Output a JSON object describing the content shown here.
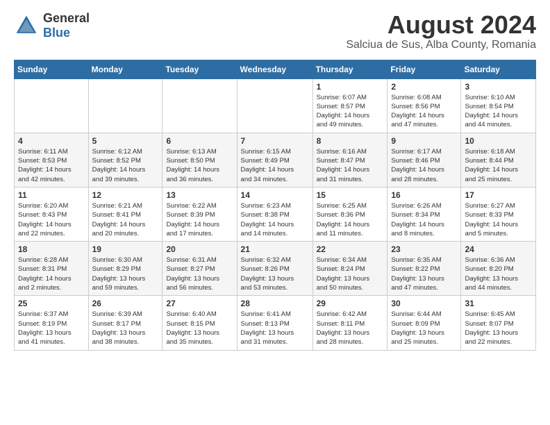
{
  "header": {
    "logo_general": "General",
    "logo_blue": "Blue",
    "month_title": "August 2024",
    "location": "Salciua de Sus, Alba County, Romania"
  },
  "calendar": {
    "days_of_week": [
      "Sunday",
      "Monday",
      "Tuesday",
      "Wednesday",
      "Thursday",
      "Friday",
      "Saturday"
    ],
    "weeks": [
      [
        {
          "day": "",
          "info": ""
        },
        {
          "day": "",
          "info": ""
        },
        {
          "day": "",
          "info": ""
        },
        {
          "day": "",
          "info": ""
        },
        {
          "day": "1",
          "info": "Sunrise: 6:07 AM\nSunset: 8:57 PM\nDaylight: 14 hours\nand 49 minutes."
        },
        {
          "day": "2",
          "info": "Sunrise: 6:08 AM\nSunset: 8:56 PM\nDaylight: 14 hours\nand 47 minutes."
        },
        {
          "day": "3",
          "info": "Sunrise: 6:10 AM\nSunset: 8:54 PM\nDaylight: 14 hours\nand 44 minutes."
        }
      ],
      [
        {
          "day": "4",
          "info": "Sunrise: 6:11 AM\nSunset: 8:53 PM\nDaylight: 14 hours\nand 42 minutes."
        },
        {
          "day": "5",
          "info": "Sunrise: 6:12 AM\nSunset: 8:52 PM\nDaylight: 14 hours\nand 39 minutes."
        },
        {
          "day": "6",
          "info": "Sunrise: 6:13 AM\nSunset: 8:50 PM\nDaylight: 14 hours\nand 36 minutes."
        },
        {
          "day": "7",
          "info": "Sunrise: 6:15 AM\nSunset: 8:49 PM\nDaylight: 14 hours\nand 34 minutes."
        },
        {
          "day": "8",
          "info": "Sunrise: 6:16 AM\nSunset: 8:47 PM\nDaylight: 14 hours\nand 31 minutes."
        },
        {
          "day": "9",
          "info": "Sunrise: 6:17 AM\nSunset: 8:46 PM\nDaylight: 14 hours\nand 28 minutes."
        },
        {
          "day": "10",
          "info": "Sunrise: 6:18 AM\nSunset: 8:44 PM\nDaylight: 14 hours\nand 25 minutes."
        }
      ],
      [
        {
          "day": "11",
          "info": "Sunrise: 6:20 AM\nSunset: 8:43 PM\nDaylight: 14 hours\nand 22 minutes."
        },
        {
          "day": "12",
          "info": "Sunrise: 6:21 AM\nSunset: 8:41 PM\nDaylight: 14 hours\nand 20 minutes."
        },
        {
          "day": "13",
          "info": "Sunrise: 6:22 AM\nSunset: 8:39 PM\nDaylight: 14 hours\nand 17 minutes."
        },
        {
          "day": "14",
          "info": "Sunrise: 6:23 AM\nSunset: 8:38 PM\nDaylight: 14 hours\nand 14 minutes."
        },
        {
          "day": "15",
          "info": "Sunrise: 6:25 AM\nSunset: 8:36 PM\nDaylight: 14 hours\nand 11 minutes."
        },
        {
          "day": "16",
          "info": "Sunrise: 6:26 AM\nSunset: 8:34 PM\nDaylight: 14 hours\nand 8 minutes."
        },
        {
          "day": "17",
          "info": "Sunrise: 6:27 AM\nSunset: 8:33 PM\nDaylight: 14 hours\nand 5 minutes."
        }
      ],
      [
        {
          "day": "18",
          "info": "Sunrise: 6:28 AM\nSunset: 8:31 PM\nDaylight: 14 hours\nand 2 minutes."
        },
        {
          "day": "19",
          "info": "Sunrise: 6:30 AM\nSunset: 8:29 PM\nDaylight: 13 hours\nand 59 minutes."
        },
        {
          "day": "20",
          "info": "Sunrise: 6:31 AM\nSunset: 8:27 PM\nDaylight: 13 hours\nand 56 minutes."
        },
        {
          "day": "21",
          "info": "Sunrise: 6:32 AM\nSunset: 8:26 PM\nDaylight: 13 hours\nand 53 minutes."
        },
        {
          "day": "22",
          "info": "Sunrise: 6:34 AM\nSunset: 8:24 PM\nDaylight: 13 hours\nand 50 minutes."
        },
        {
          "day": "23",
          "info": "Sunrise: 6:35 AM\nSunset: 8:22 PM\nDaylight: 13 hours\nand 47 minutes."
        },
        {
          "day": "24",
          "info": "Sunrise: 6:36 AM\nSunset: 8:20 PM\nDaylight: 13 hours\nand 44 minutes."
        }
      ],
      [
        {
          "day": "25",
          "info": "Sunrise: 6:37 AM\nSunset: 8:19 PM\nDaylight: 13 hours\nand 41 minutes."
        },
        {
          "day": "26",
          "info": "Sunrise: 6:39 AM\nSunset: 8:17 PM\nDaylight: 13 hours\nand 38 minutes."
        },
        {
          "day": "27",
          "info": "Sunrise: 6:40 AM\nSunset: 8:15 PM\nDaylight: 13 hours\nand 35 minutes."
        },
        {
          "day": "28",
          "info": "Sunrise: 6:41 AM\nSunset: 8:13 PM\nDaylight: 13 hours\nand 31 minutes."
        },
        {
          "day": "29",
          "info": "Sunrise: 6:42 AM\nSunset: 8:11 PM\nDaylight: 13 hours\nand 28 minutes."
        },
        {
          "day": "30",
          "info": "Sunrise: 6:44 AM\nSunset: 8:09 PM\nDaylight: 13 hours\nand 25 minutes."
        },
        {
          "day": "31",
          "info": "Sunrise: 6:45 AM\nSunset: 8:07 PM\nDaylight: 13 hours\nand 22 minutes."
        }
      ]
    ]
  }
}
